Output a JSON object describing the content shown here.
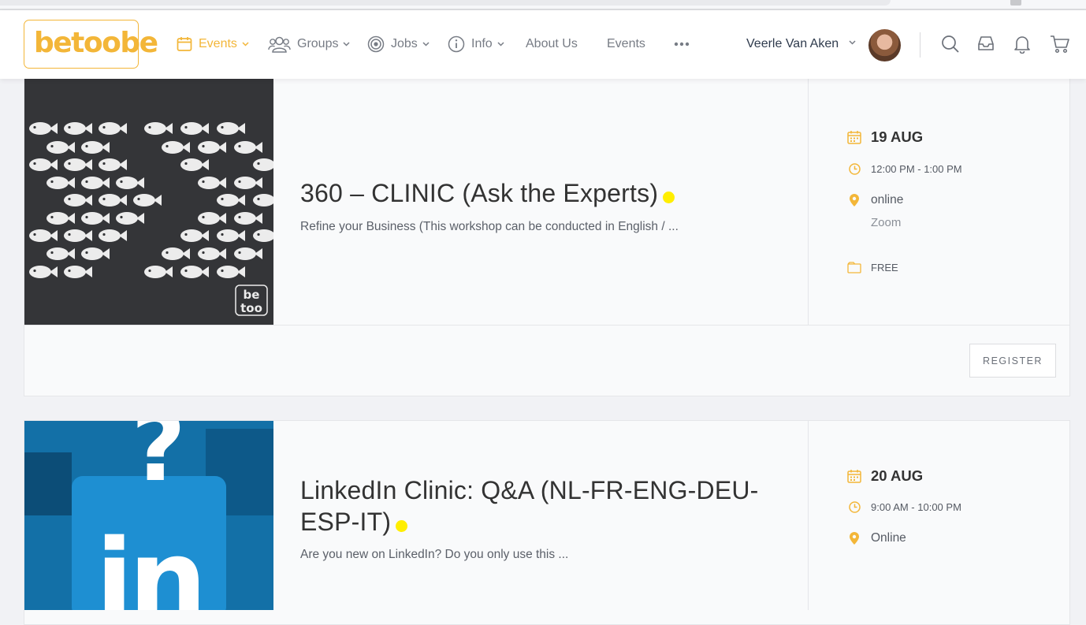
{
  "header": {
    "logo_text": "betoobe",
    "nav": [
      {
        "label": "Events",
        "icon": "calendar-icon",
        "active": true,
        "has_dropdown": true
      },
      {
        "label": "Groups",
        "icon": "groups-icon",
        "active": false,
        "has_dropdown": true
      },
      {
        "label": "Jobs",
        "icon": "target-icon",
        "active": false,
        "has_dropdown": true
      },
      {
        "label": "Info",
        "icon": "info-icon",
        "active": false,
        "has_dropdown": true
      },
      {
        "label": "About Us",
        "active": false,
        "has_dropdown": false
      },
      {
        "label": "Events",
        "active": false,
        "has_dropdown": false
      }
    ],
    "more_icon": "more-dots-icon",
    "user_name": "Veerle Van Aken",
    "icons": [
      "search-icon",
      "inbox-icon",
      "bell-icon",
      "cart-icon"
    ]
  },
  "events": [
    {
      "title": "360 – CLINIC (Ask the Experts)",
      "excerpt": "Refine your Business (This workshop can be conducted in English / ...",
      "date": "19 AUG",
      "time": "12:00 PM - 1:00 PM",
      "location": "online",
      "venue": "Zoom",
      "price": "FREE",
      "register_label": "REGISTER",
      "image_text": "be too"
    },
    {
      "title": "LinkedIn Clinic: Q&A (NL-FR-ENG-DEU-ESP-IT)",
      "excerpt": "Are you new on LinkedIn? Do you only use this ...",
      "date": "20 AUG",
      "time": "9:00 AM - 10:00 PM",
      "location": "Online"
    }
  ],
  "colors": {
    "accent": "#f3b638",
    "status_dot": "#ffee00",
    "fish_bg": "#343538",
    "linkedin_blue": "#1a86c4"
  }
}
